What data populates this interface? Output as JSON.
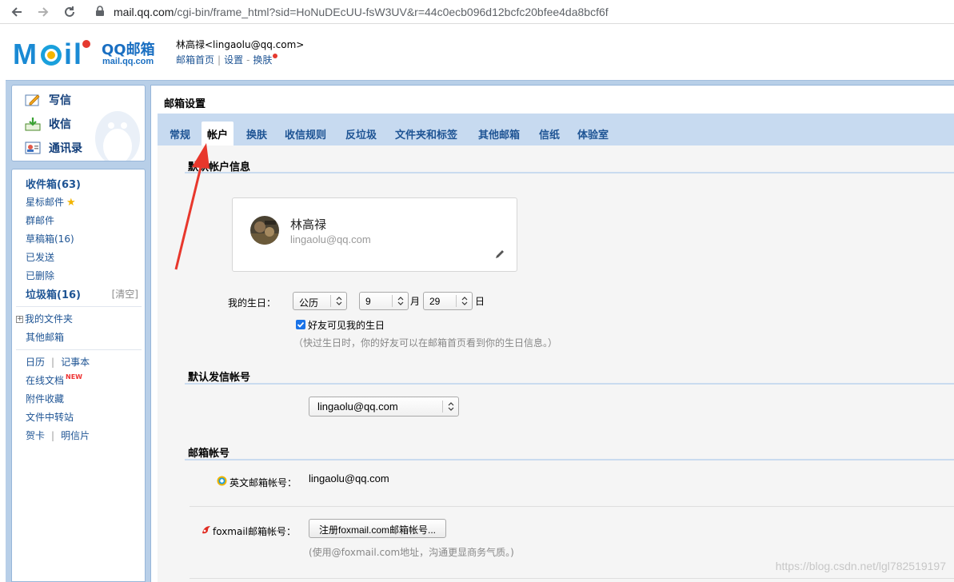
{
  "browser": {
    "url_domain": "mail.qq.com",
    "url_rest": "/cgi-bin/frame_html?sid=HoNuDEcUU-fsW3UV&r=44c0ecb096d12bcfc20bfee4da8bcf6f"
  },
  "header": {
    "logo_brand": "QQ邮箱",
    "logo_domain": "mail.qq.com",
    "user_name": "林高禄<lingaolu@qq.com>",
    "link_home": "邮箱首页",
    "link_sep": "|",
    "link_settings": "设置",
    "link_dash": "-",
    "link_skin": "换肤"
  },
  "quick": {
    "write": "写信",
    "receive": "收信",
    "contacts": "通讯录"
  },
  "folders": {
    "inbox": "收件箱(63)",
    "starred": "星标邮件",
    "group": "群邮件",
    "drafts": "草稿箱(16)",
    "sent": "已发送",
    "deleted": "已删除",
    "spam": "垃圾箱(16)",
    "clear": "[清空]",
    "my_folders": "我的文件夹",
    "other_mail": "其他邮箱",
    "calendar": "日历",
    "pipe": "|",
    "notes": "记事本",
    "online_docs": "在线文档",
    "new_tag": "NEW",
    "attachments": "附件收藏",
    "file_transfer": "文件中转站",
    "cards": "贺卡",
    "postcards": "明信片"
  },
  "main": {
    "title": "邮箱设置",
    "tabs": [
      "常规",
      "帐户",
      "换肤",
      "收信规则",
      "反垃圾",
      "文件夹和标签",
      "其他邮箱",
      "信纸",
      "体验室"
    ],
    "active_tab": "帐户"
  },
  "account": {
    "section_default": "默认帐户信息",
    "card_name": "林高禄",
    "card_email": "lingaolu@qq.com",
    "birthday_label": "我的生日：",
    "calendar_type": "公历",
    "month": "9",
    "month_unit": "月",
    "day": "29",
    "day_unit": "日",
    "friends_visible": "好友可见我的生日",
    "friends_visible_checked": true,
    "birthday_hint": "（快过生日时，你的好友可以在邮箱首页看到你的生日信息。）",
    "section_sender": "默认发信帐号",
    "sender_value": "lingaolu@qq.com",
    "section_accounts": "邮箱帐号",
    "english_label": "英文邮箱帐号：",
    "english_value": "lingaolu@qq.com",
    "foxmail_label": "foxmail邮箱帐号：",
    "foxmail_button": "注册foxmail.com邮箱帐号...",
    "foxmail_hint": "(使用@foxmail.com地址，沟通更显商务气质。)"
  },
  "watermark": "https://blog.csdn.net/lgl782519197",
  "colors": {
    "frame_blue": "#b8cfe8",
    "link_blue": "#1e5494",
    "annotation_red": "#e8372c"
  }
}
